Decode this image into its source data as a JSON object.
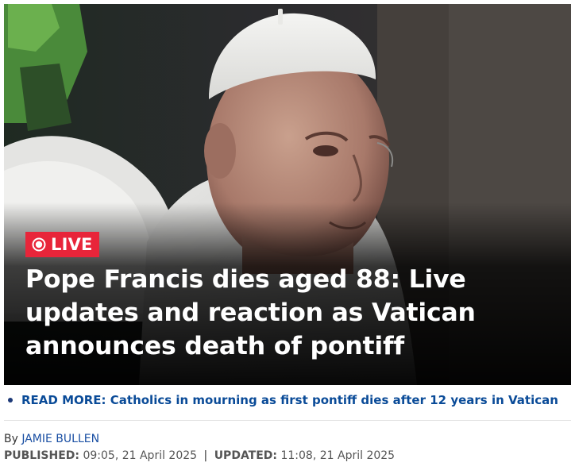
{
  "article": {
    "live_label": "LIVE",
    "headline": "Pope Francis dies aged 88: Live updates and reaction as Vatican announces death of pontiff",
    "image_icon": "photo-of-pope",
    "live_icon": "live-dot-icon",
    "accent_color": "#e8253a"
  },
  "read_more": {
    "text": "READ MORE: Catholics in mourning as first pontiff dies after 12 years in Vatican",
    "link_color": "#0a4b98"
  },
  "byline": {
    "prefix": "By",
    "author": "JAMIE BULLEN"
  },
  "dates": {
    "published_label": "PUBLISHED:",
    "published_value": "09:05, 21 April 2025",
    "separator": "|",
    "updated_label": "UPDATED:",
    "updated_value": "11:08, 21 April 2025"
  }
}
